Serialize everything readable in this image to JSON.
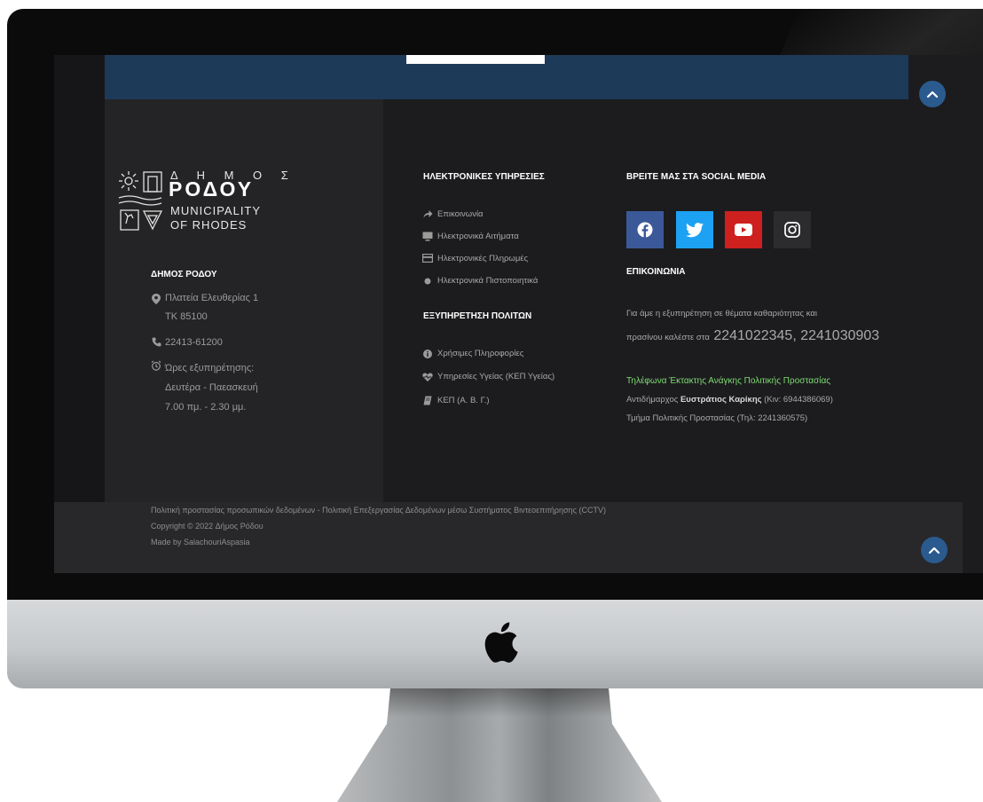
{
  "logo": {
    "line1": "Δ Η Μ Ο Σ",
    "line2": "ΡΟΔΟΥ",
    "line3": "MUNICIPALITY",
    "line4": "OF RHODES"
  },
  "municipality": {
    "heading": "ΔΗΜΟΣ ΡΟΔΟΥ",
    "address_line1": "Πλατεία Ελευθερίας 1",
    "address_line2": "ΤΚ 85100",
    "phone": "22413-61200",
    "hours_label": "Ώρες εξυπηρέτησης:",
    "hours_days": "Δευτέρα - Παεασκευή",
    "hours_time": "7.00 πμ. - 2.30 μμ."
  },
  "eservices": {
    "heading": "ΗΛΕΚΤΡΟΝΙΚΕΣ ΥΠΗΡΕΣΙΕΣ",
    "items": [
      {
        "label": "Επικοινωνία",
        "icon": "share-arrow-icon"
      },
      {
        "label": "Ηλεκτρονικά Αιτήματα",
        "icon": "monitor-icon"
      },
      {
        "label": "Ηλεκτρονικές Πληρωμές",
        "icon": "credit-card-icon"
      },
      {
        "label": "Ηλεκτρονικά Πιστοποιητικά",
        "icon": "dot-icon"
      }
    ]
  },
  "citizens": {
    "heading": "ΕΞΥΠΗΡΕΤΗΣΗ ΠΟΛΙΤΩΝ",
    "items": [
      {
        "label": "Χρήσιμες Πληροφορίες",
        "icon": "info-icon"
      },
      {
        "label": "Υπηρεσίες Υγείας (ΚΕΠ Υγείας)",
        "icon": "heartbeat-icon"
      },
      {
        "label": "ΚΕΠ (Α. Β. Γ.)",
        "icon": "book-icon"
      }
    ]
  },
  "social": {
    "heading": "ΒΡΕΙΤΕ ΜΑΣ ΣΤΑ SOCIAL MEDIA",
    "items": [
      {
        "name": "facebook",
        "color": "#3b5998"
      },
      {
        "name": "twitter",
        "color": "#1da1f2"
      },
      {
        "name": "youtube",
        "color": "#cd201f"
      },
      {
        "name": "instagram",
        "color": "#2c2c2e"
      }
    ]
  },
  "contact": {
    "heading": "ΕΠΙΚΟΙΝΩΝΙΑ",
    "line1": "Για άμε   η εξυπηρέτηση σε θέματα καθαριότητας και",
    "line2_prefix": "πρασίνου καλέστε στα",
    "phones": "2241022345, 2241030903",
    "emergency_title": "Τηλέφωνα Έκτακτης Ανάγκης Πολιτικής Προστασίας",
    "deputy_prefix": "Αντιδήμαρχος",
    "deputy_name": "Ευστράτιος Καρίκης",
    "deputy_phone": "(Κιν: 6944386069)",
    "dept": "Τμήμα Πολιτικής Προστασίας  (Τηλ: 2241360575)"
  },
  "footer": {
    "policies": "Πολιτική προστασίας προσωπικών δεδομένων - Πολιτική Επεξεργασίας Δεδομένων μέσω Συστήματος Βιντεοεπιτήρησης (CCTV)",
    "copyright": "Copyright © 2022 Δήμος Ρόδου",
    "made_by": "Made by SalachouriAspasia"
  },
  "colors": {
    "accent": "#2a5a8e",
    "banner": "#1d3a58",
    "green_text": "#7ddc73"
  }
}
